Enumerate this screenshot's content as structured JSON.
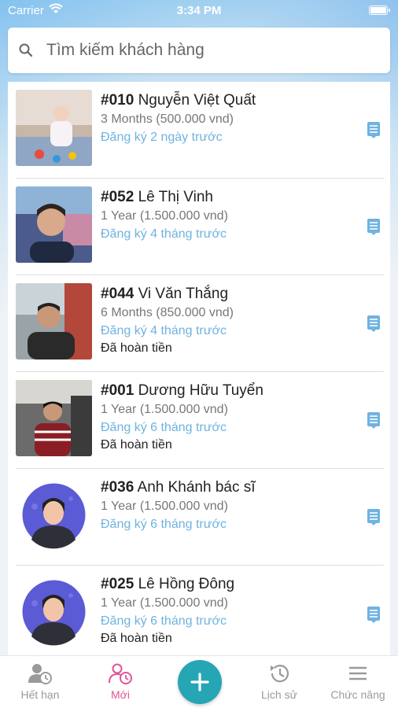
{
  "status_bar": {
    "carrier": "Carrier",
    "time": "3:34 PM"
  },
  "search": {
    "placeholder": "Tìm kiếm khách hàng",
    "value": ""
  },
  "customers": [
    {
      "id": "#010",
      "name": "Nguyễn Việt Quất",
      "plan": "3 Months (500.000 vnd)",
      "registered": "Đăng ký 2 ngày trước",
      "refund": "",
      "avatar": "photo"
    },
    {
      "id": "#052",
      "name": "Lê Thị Vinh",
      "plan": "1 Year (1.500.000 vnd)",
      "registered": "Đăng ký 4 tháng trước",
      "refund": "",
      "avatar": "photo"
    },
    {
      "id": "#044",
      "name": "Vi Văn Thắng",
      "plan": "6 Months (850.000 vnd)",
      "registered": "Đăng ký 4 tháng trước",
      "refund": "Đã hoàn tiền",
      "avatar": "photo"
    },
    {
      "id": "#001",
      "name": "Dương Hữu Tuyển",
      "plan": "1 Year (1.500.000 vnd)",
      "registered": "Đăng ký 6 tháng trước",
      "refund": "Đã hoàn tiền",
      "avatar": "photo"
    },
    {
      "id": "#036",
      "name": "Anh Khánh bác sĩ",
      "plan": "1 Year (1.500.000 vnd)",
      "registered": "Đăng ký 6 tháng trước",
      "refund": "",
      "avatar": "default"
    },
    {
      "id": "#025",
      "name": "Lê Hồng Đông",
      "plan": "1 Year (1.500.000 vnd)",
      "registered": "Đăng ký 6 tháng trước",
      "refund": "Đã hoàn tiền",
      "avatar": "default"
    }
  ],
  "tabs": [
    {
      "label": "Hết hạn",
      "icon": "user-clock-icon",
      "active": false
    },
    {
      "label": "Mới",
      "icon": "user-new-icon",
      "active": true
    },
    {
      "label": "Lịch sử",
      "icon": "history-icon",
      "active": false
    },
    {
      "label": "Chức năng",
      "icon": "menu-icon",
      "active": false
    }
  ],
  "colors": {
    "accent": "#26a6b4",
    "active_tab": "#e0559a",
    "registered_text": "#6fb3e0",
    "default_avatar_bg": "#5b5bd6"
  }
}
